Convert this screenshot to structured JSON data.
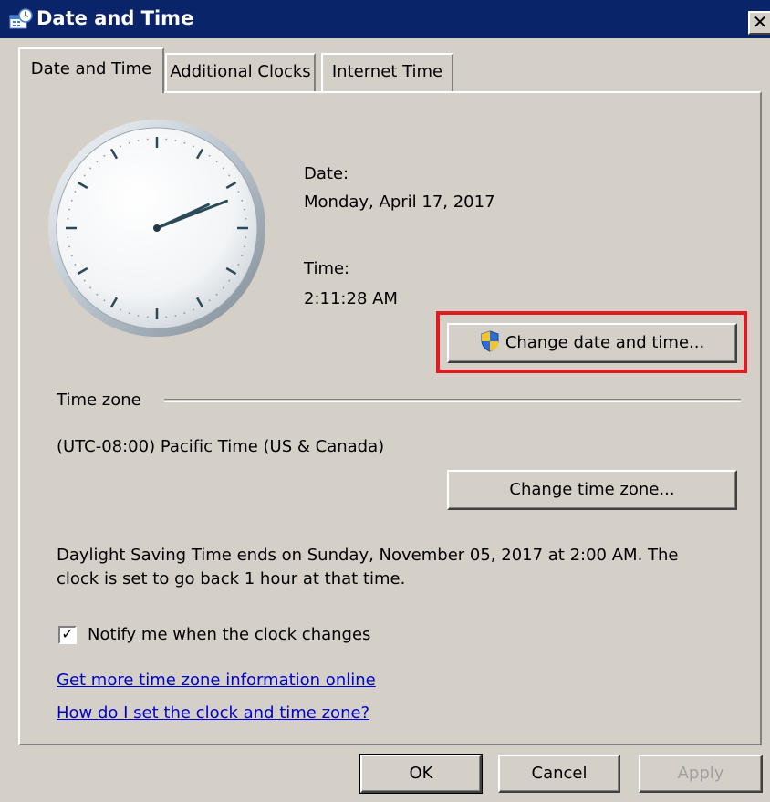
{
  "window": {
    "title": "Date and Time",
    "close_glyph": "✕"
  },
  "tabs": [
    {
      "label": "Date and Time",
      "active": true
    },
    {
      "label": "Additional Clocks",
      "active": false
    },
    {
      "label": "Internet Time",
      "active": false
    }
  ],
  "clock": {
    "hour": 2,
    "minute": 11,
    "second": 28
  },
  "date": {
    "label": "Date:",
    "value": "Monday, April 17, 2017"
  },
  "time": {
    "label": "Time:",
    "value": "2:11:28 AM"
  },
  "buttons": {
    "change_date_time": "Change date and time...",
    "change_time_zone": "Change time zone...",
    "ok": "OK",
    "cancel": "Cancel",
    "apply": "Apply"
  },
  "time_zone": {
    "heading": "Time zone",
    "value": "(UTC-08:00) Pacific Time (US & Canada)"
  },
  "dst_message": {
    "line1": "Daylight Saving Time ends on Sunday, November 05, 2017 at 2:00 AM. The",
    "line2": "clock is set to go back 1 hour at that time."
  },
  "notify": {
    "label": "Notify me when the clock changes",
    "checked": true,
    "check_glyph": "✓"
  },
  "links": {
    "more_info": "Get more time zone information online",
    "how_to": "How do I set the clock and time zone?"
  },
  "colors": {
    "highlight": "#e11b22",
    "link": "#0000cc",
    "titlebar": "#0a246a"
  },
  "icons": {
    "title": "calendar-clock-icon",
    "shield": "uac-shield-icon",
    "close": "close-icon"
  }
}
